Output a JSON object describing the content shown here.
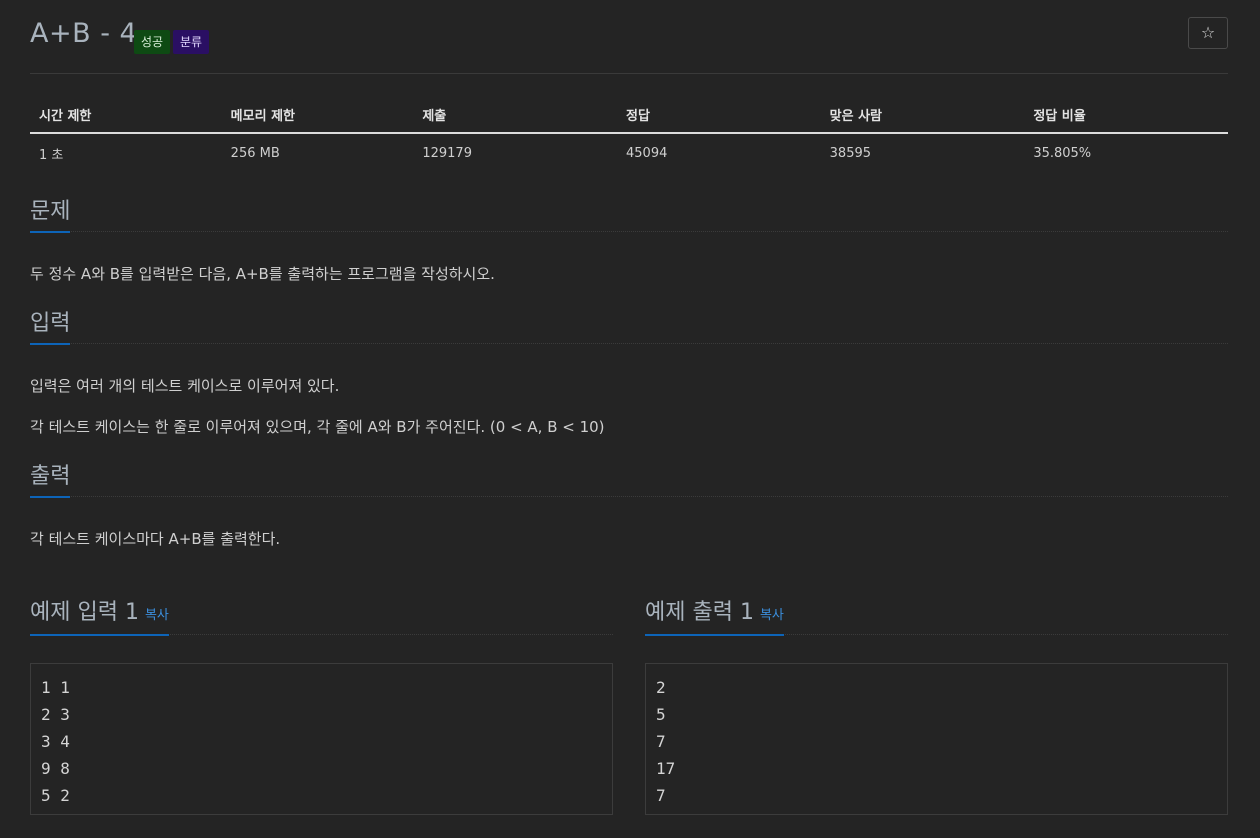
{
  "header": {
    "title": "A+B - 4",
    "badge_success": "성공",
    "badge_category": "분류",
    "star_icon": "☆"
  },
  "info_table": {
    "headers": [
      "시간 제한",
      "메모리 제한",
      "제출",
      "정답",
      "맞은 사람",
      "정답 비율"
    ],
    "values": [
      "1 초",
      "256 MB",
      "129179",
      "45094",
      "38595",
      "35.805%"
    ]
  },
  "problem": {
    "heading": "문제",
    "text": "두 정수 A와 B를 입력받은 다음, A+B를 출력하는 프로그램을 작성하시오."
  },
  "input": {
    "heading": "입력",
    "lines": [
      "입력은 여러 개의 테스트 케이스로 이루어져 있다.",
      "각 테스트 케이스는 한 줄로 이루어져 있으며, 각 줄에 A와 B가 주어진다. (0 < A, B < 10)"
    ]
  },
  "output": {
    "heading": "출력",
    "text": "각 테스트 케이스마다 A+B를 출력한다."
  },
  "samples": {
    "input_title": "예제 입력 1",
    "output_title": "예제 출력 1",
    "copy_label": "복사",
    "input_body": "1 1\n2 3\n3 4\n9 8\n5 2",
    "output_body": "2\n5\n7\n17\n7"
  }
}
